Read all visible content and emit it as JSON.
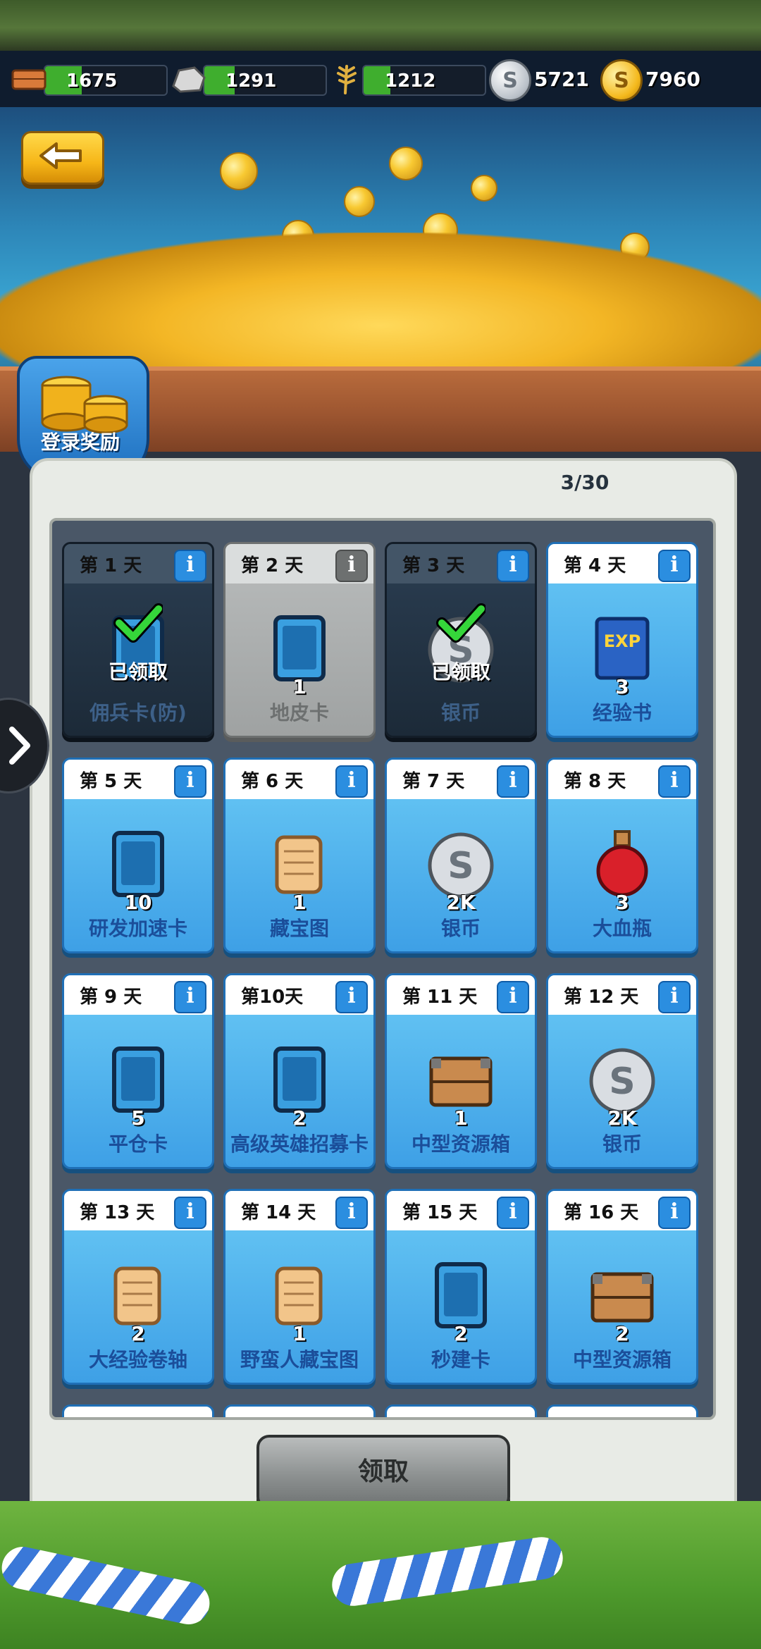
{
  "resources": [
    {
      "name": "brick",
      "value": "1675",
      "fill_pct": 30,
      "color": "#d97a3a"
    },
    {
      "name": "stone",
      "value": "1291",
      "fill_pct": 25,
      "color": "#c9c9c9"
    },
    {
      "name": "wheat",
      "value": "1212",
      "fill_pct": 22,
      "color": "#e0b040"
    }
  ],
  "currencies": [
    {
      "name": "silver",
      "value": "5721",
      "symbol": "S",
      "color": "#d9dde2"
    },
    {
      "name": "gold",
      "value": "7960",
      "symbol": "S",
      "color": "#f4b81c"
    }
  ],
  "badge": {
    "title": "登录奖励"
  },
  "progress": "3/30",
  "cards": [
    {
      "day": "第 1 天",
      "name": "佣兵卡(防)",
      "qty": "",
      "state": "claimed",
      "claimed_label": "已领取",
      "icon": "mercenary-card-icon"
    },
    {
      "day": "第 2 天",
      "name": "地皮卡",
      "qty": "1",
      "state": "missed",
      "claimed_label": "",
      "icon": "land-card-icon"
    },
    {
      "day": "第 3 天",
      "name": "银币",
      "qty": "",
      "state": "claimed",
      "claimed_label": "已领取",
      "icon": "silver-coin-icon"
    },
    {
      "day": "第 4 天",
      "name": "经验书",
      "qty": "3",
      "state": "available",
      "claimed_label": "",
      "icon": "exp-book-icon"
    },
    {
      "day": "第 5 天",
      "name": "研发加速卡",
      "qty": "10",
      "state": "available",
      "claimed_label": "",
      "icon": "research-speedup-card-icon"
    },
    {
      "day": "第 6 天",
      "name": "藏宝图",
      "qty": "1",
      "state": "available",
      "claimed_label": "",
      "icon": "treasure-map-icon"
    },
    {
      "day": "第 7 天",
      "name": "银币",
      "qty": "2K",
      "state": "available",
      "claimed_label": "",
      "icon": "silver-coin-icon"
    },
    {
      "day": "第 8 天",
      "name": "大血瓶",
      "qty": "3",
      "state": "available",
      "claimed_label": "",
      "icon": "health-potion-icon"
    },
    {
      "day": "第 9 天",
      "name": "平仓卡",
      "qty": "5",
      "state": "available",
      "claimed_label": "",
      "icon": "balance-card-icon"
    },
    {
      "day": "第10天",
      "name": "高级英雄招募卡",
      "qty": "2",
      "state": "available",
      "claimed_label": "",
      "icon": "hero-recruit-card-icon"
    },
    {
      "day": "第 11 天",
      "name": "中型资源箱",
      "qty": "1",
      "state": "available",
      "claimed_label": "",
      "icon": "resource-crate-icon"
    },
    {
      "day": "第 12 天",
      "name": "银币",
      "qty": "2K",
      "state": "available",
      "claimed_label": "",
      "icon": "silver-coin-icon"
    },
    {
      "day": "第 13 天",
      "name": "大经验卷轴",
      "qty": "2",
      "state": "available",
      "claimed_label": "",
      "icon": "exp-scroll-icon"
    },
    {
      "day": "第 14 天",
      "name": "野蛮人藏宝图",
      "qty": "1",
      "state": "available",
      "claimed_label": "",
      "icon": "barbarian-treasure-map-icon"
    },
    {
      "day": "第 15 天",
      "name": "秒建卡",
      "qty": "2",
      "state": "available",
      "claimed_label": "",
      "icon": "instant-build-card-icon"
    },
    {
      "day": "第 16 天",
      "name": "中型资源箱",
      "qty": "2",
      "state": "available",
      "claimed_label": "",
      "icon": "resource-crate-icon"
    }
  ],
  "claim_button": {
    "label": "领取"
  }
}
